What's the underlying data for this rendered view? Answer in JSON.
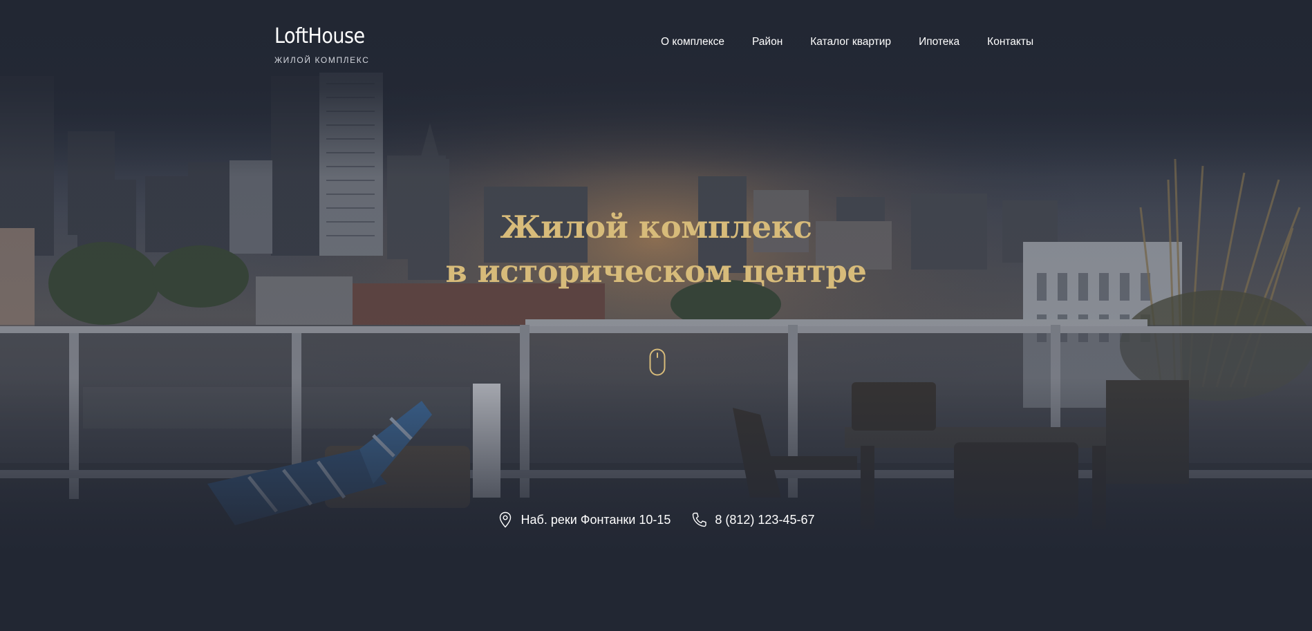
{
  "brand": {
    "name": "LoftHouse",
    "tagline": "ЖИЛОЙ КОМПЛЕКС"
  },
  "nav": {
    "items": [
      {
        "label": "О комплексе"
      },
      {
        "label": "Район"
      },
      {
        "label": "Каталог квартир"
      },
      {
        "label": "Ипотека"
      },
      {
        "label": "Контакты"
      }
    ]
  },
  "hero": {
    "title_line1": "Жилой комплекс",
    "title_line2": "в историческом центре",
    "scroll_icon": "mouse-icon",
    "background": "city-rooftop-terrace-photo"
  },
  "contacts": {
    "address": "Наб. реки Фонтанки 10-15",
    "address_icon": "location-pin-icon",
    "phone": "8 (812) 123-45-67",
    "phone_icon": "phone-icon"
  },
  "colors": {
    "accent": "#d7bb7a",
    "background": "#222733",
    "text": "#ffffff"
  }
}
